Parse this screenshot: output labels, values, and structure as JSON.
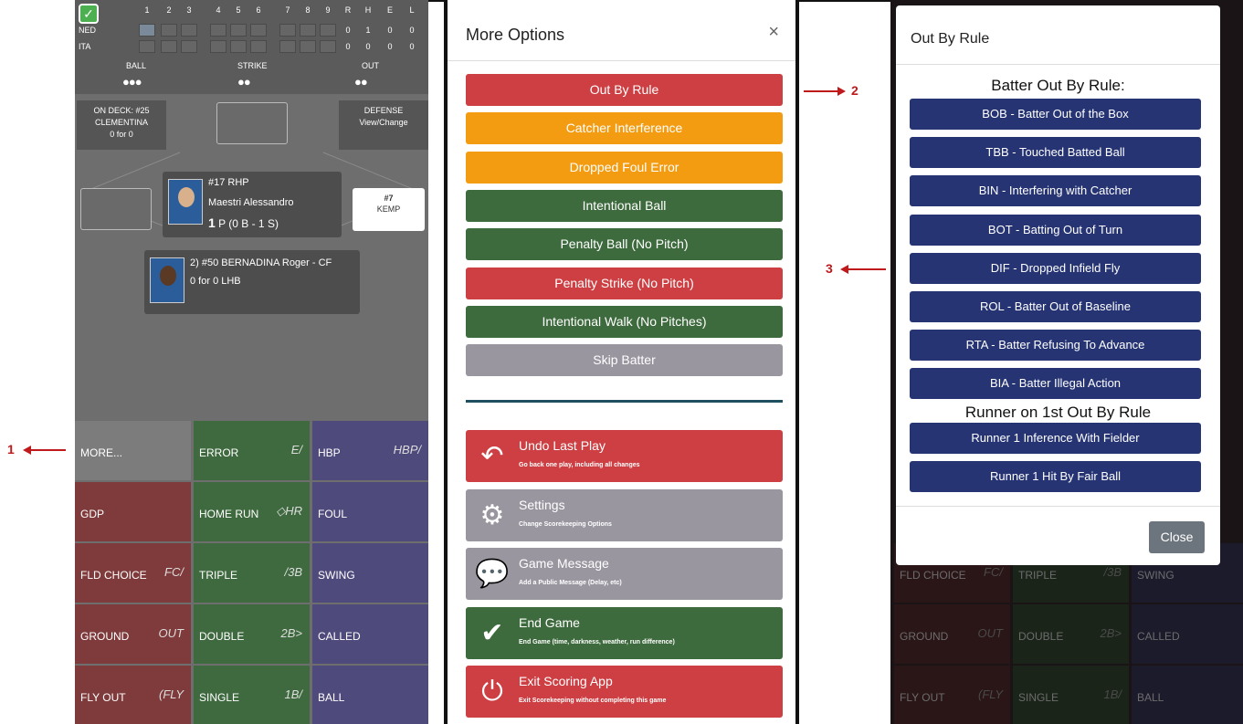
{
  "annotations": [
    "1",
    "2",
    "3"
  ],
  "scoreboard": {
    "innings": [
      "1",
      "2",
      "3",
      "4",
      "5",
      "6",
      "7",
      "8",
      "9"
    ],
    "totals_headers": [
      "R",
      "H",
      "E",
      "L"
    ],
    "teams": [
      {
        "name": "NED",
        "totals": [
          "0",
          "1",
          "0",
          "0"
        ]
      },
      {
        "name": "ITA",
        "totals": [
          "0",
          "0",
          "0",
          "0"
        ]
      }
    ],
    "count_labels": [
      "BALL",
      "STRIKE",
      "OUT"
    ],
    "count_dots": [
      "●●●",
      "●●",
      "●●"
    ]
  },
  "field": {
    "on_deck": {
      "line1": "ON DECK: #25",
      "line2": "CLEMENTINA",
      "line3": "0 for 0"
    },
    "defense": {
      "line1": "DEFENSE",
      "line2": "View/Change"
    },
    "pitcher": {
      "number": "#17 RHP",
      "name": "Maestri Alessandro",
      "count_big": "1",
      "count_rest": "P (0 B - 1 S)"
    },
    "first_base": {
      "number": "#7",
      "name": "KEMP"
    },
    "batter": {
      "name": "2) #50 BERNADINA Roger - CF",
      "stats": "0 for 0 LHB"
    }
  },
  "play_grid": [
    {
      "label": "MORE...",
      "color": "grey",
      "sym": ""
    },
    {
      "label": "ERROR",
      "color": "green",
      "sym": "E/"
    },
    {
      "label": "HBP",
      "color": "purple",
      "sym": "HBP/"
    },
    {
      "label": "GDP",
      "color": "red",
      "sym": ""
    },
    {
      "label": "HOME RUN",
      "color": "green",
      "sym": "◇HR"
    },
    {
      "label": "FOUL",
      "color": "purple",
      "sym": ""
    },
    {
      "label": "FLD CHOICE",
      "color": "red",
      "sym": "FC/"
    },
    {
      "label": "TRIPLE",
      "color": "green",
      "sym": "/3B"
    },
    {
      "label": "SWING",
      "color": "purple",
      "sym": ""
    },
    {
      "label": "GROUND",
      "color": "red",
      "sym": "OUT"
    },
    {
      "label": "DOUBLE",
      "color": "green",
      "sym": "2B>"
    },
    {
      "label": "CALLED",
      "color": "purple",
      "sym": ""
    },
    {
      "label": "FLY OUT",
      "color": "red",
      "sym": "(FLY"
    },
    {
      "label": "SINGLE",
      "color": "green",
      "sym": "1B/"
    },
    {
      "label": "BALL",
      "color": "purple",
      "sym": ""
    }
  ],
  "more_options": {
    "title": "More Options",
    "close_symbol": "×",
    "buttons": [
      {
        "label": "Out By Rule",
        "color": "red"
      },
      {
        "label": "Catcher Interference",
        "color": "orange"
      },
      {
        "label": "Dropped Foul Error",
        "color": "orange"
      },
      {
        "label": "Intentional Ball",
        "color": "green"
      },
      {
        "label": "Penalty Ball (No Pitch)",
        "color": "green"
      },
      {
        "label": "Penalty Strike (No Pitch)",
        "color": "red"
      },
      {
        "label": "Intentional Walk (No Pitches)",
        "color": "green"
      },
      {
        "label": "Skip Batter",
        "color": "grey"
      }
    ],
    "actions": [
      {
        "title": "Undo Last Play",
        "sub": "Go back one play, including all changes",
        "color": "red",
        "icon": "undo-icon"
      },
      {
        "title": "Settings",
        "sub": "Change Scorekeeping Options",
        "color": "grey",
        "icon": "gear-icon"
      },
      {
        "title": "Game Message",
        "sub": "Add a Public Message (Delay, etc)",
        "color": "grey",
        "icon": "chat-icon"
      },
      {
        "title": "End Game",
        "sub": "End Game (time, darkness, weather, run difference)",
        "color": "green",
        "icon": "check-icon"
      },
      {
        "title": "Exit Scoring App",
        "sub": "Exit Scorekeeping without completing this game",
        "color": "red",
        "icon": "power-icon"
      }
    ]
  },
  "out_by_rule": {
    "title": "Out By Rule",
    "batter_heading": "Batter Out By Rule:",
    "batter_rules": [
      "BOB - Batter Out of the Box",
      "TBB - Touched Batted Ball",
      "BIN - Interfering with Catcher",
      "BOT - Batting Out of Turn",
      "DIF - Dropped Infield Fly",
      "ROL - Batter Out of Baseline",
      "RTA - Batter Refusing To Advance",
      "BIA - Batter Illegal Action"
    ],
    "runner_heading": "Runner on 1st Out By Rule",
    "runner_rules": [
      "Runner 1 Inference With Fielder",
      "Runner 1 Hit By Fair Ball"
    ],
    "close_label": "Close"
  },
  "background_grid": [
    {
      "label": "FLD CHOICE",
      "sym": "FC/"
    },
    {
      "label": "TRIPLE",
      "sym": "/3B"
    },
    {
      "label": "SWING",
      "sym": ""
    },
    {
      "label": "GROUND",
      "sym": "OUT"
    },
    {
      "label": "DOUBLE",
      "sym": "2B>"
    },
    {
      "label": "CALLED",
      "sym": ""
    },
    {
      "label": "FLY OUT",
      "sym": "(FLY"
    },
    {
      "label": "SINGLE",
      "sym": "1B/"
    },
    {
      "label": "BALL",
      "sym": ""
    }
  ],
  "colors": {
    "red": "#cd3f43",
    "orange": "#f39c12",
    "green": "#3e6b3e",
    "grey": "#9a96a0",
    "navy": "#263473",
    "annotation": "#c0191b"
  }
}
